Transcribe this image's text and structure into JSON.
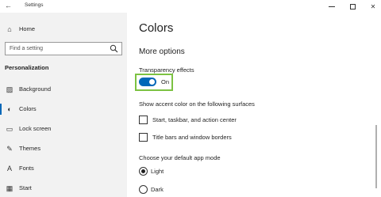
{
  "window": {
    "title": "Settings",
    "back_glyph": "←",
    "close_glyph": "✕"
  },
  "sidebar": {
    "home": {
      "label": "Home",
      "icon": "home-icon",
      "glyph": "⌂"
    },
    "search": {
      "placeholder": "Find a setting",
      "icon": "search-icon"
    },
    "section_title": "Personalization",
    "items": [
      {
        "label": "Background",
        "icon": "picture-icon",
        "glyph": "▨"
      },
      {
        "label": "Colors",
        "icon": "palette-icon",
        "glyph": "◐",
        "selected": true
      },
      {
        "label": "Lock screen",
        "icon": "monitor-icon",
        "glyph": "▭"
      },
      {
        "label": "Themes",
        "icon": "brush-icon",
        "glyph": "✎"
      },
      {
        "label": "Fonts",
        "icon": "font-icon",
        "glyph": "A"
      },
      {
        "label": "Start",
        "icon": "start-icon",
        "glyph": "▦"
      }
    ]
  },
  "main": {
    "title": "Colors",
    "section": "More options",
    "transparency": {
      "label": "Transparency effects",
      "state": "On",
      "on": true
    },
    "accent": {
      "label": "Show accent color on the following surfaces",
      "options": [
        {
          "label": "Start, taskbar, and action center",
          "checked": false
        },
        {
          "label": "Title bars and window borders",
          "checked": false
        }
      ]
    },
    "app_mode": {
      "label": "Choose your default app mode",
      "options": [
        {
          "label": "Light",
          "selected": true
        },
        {
          "label": "Dark",
          "selected": false
        }
      ]
    }
  },
  "colors": {
    "accent": "#0067b8",
    "highlight": "#7cc242",
    "sidebar_bg": "#f2f2f2"
  }
}
